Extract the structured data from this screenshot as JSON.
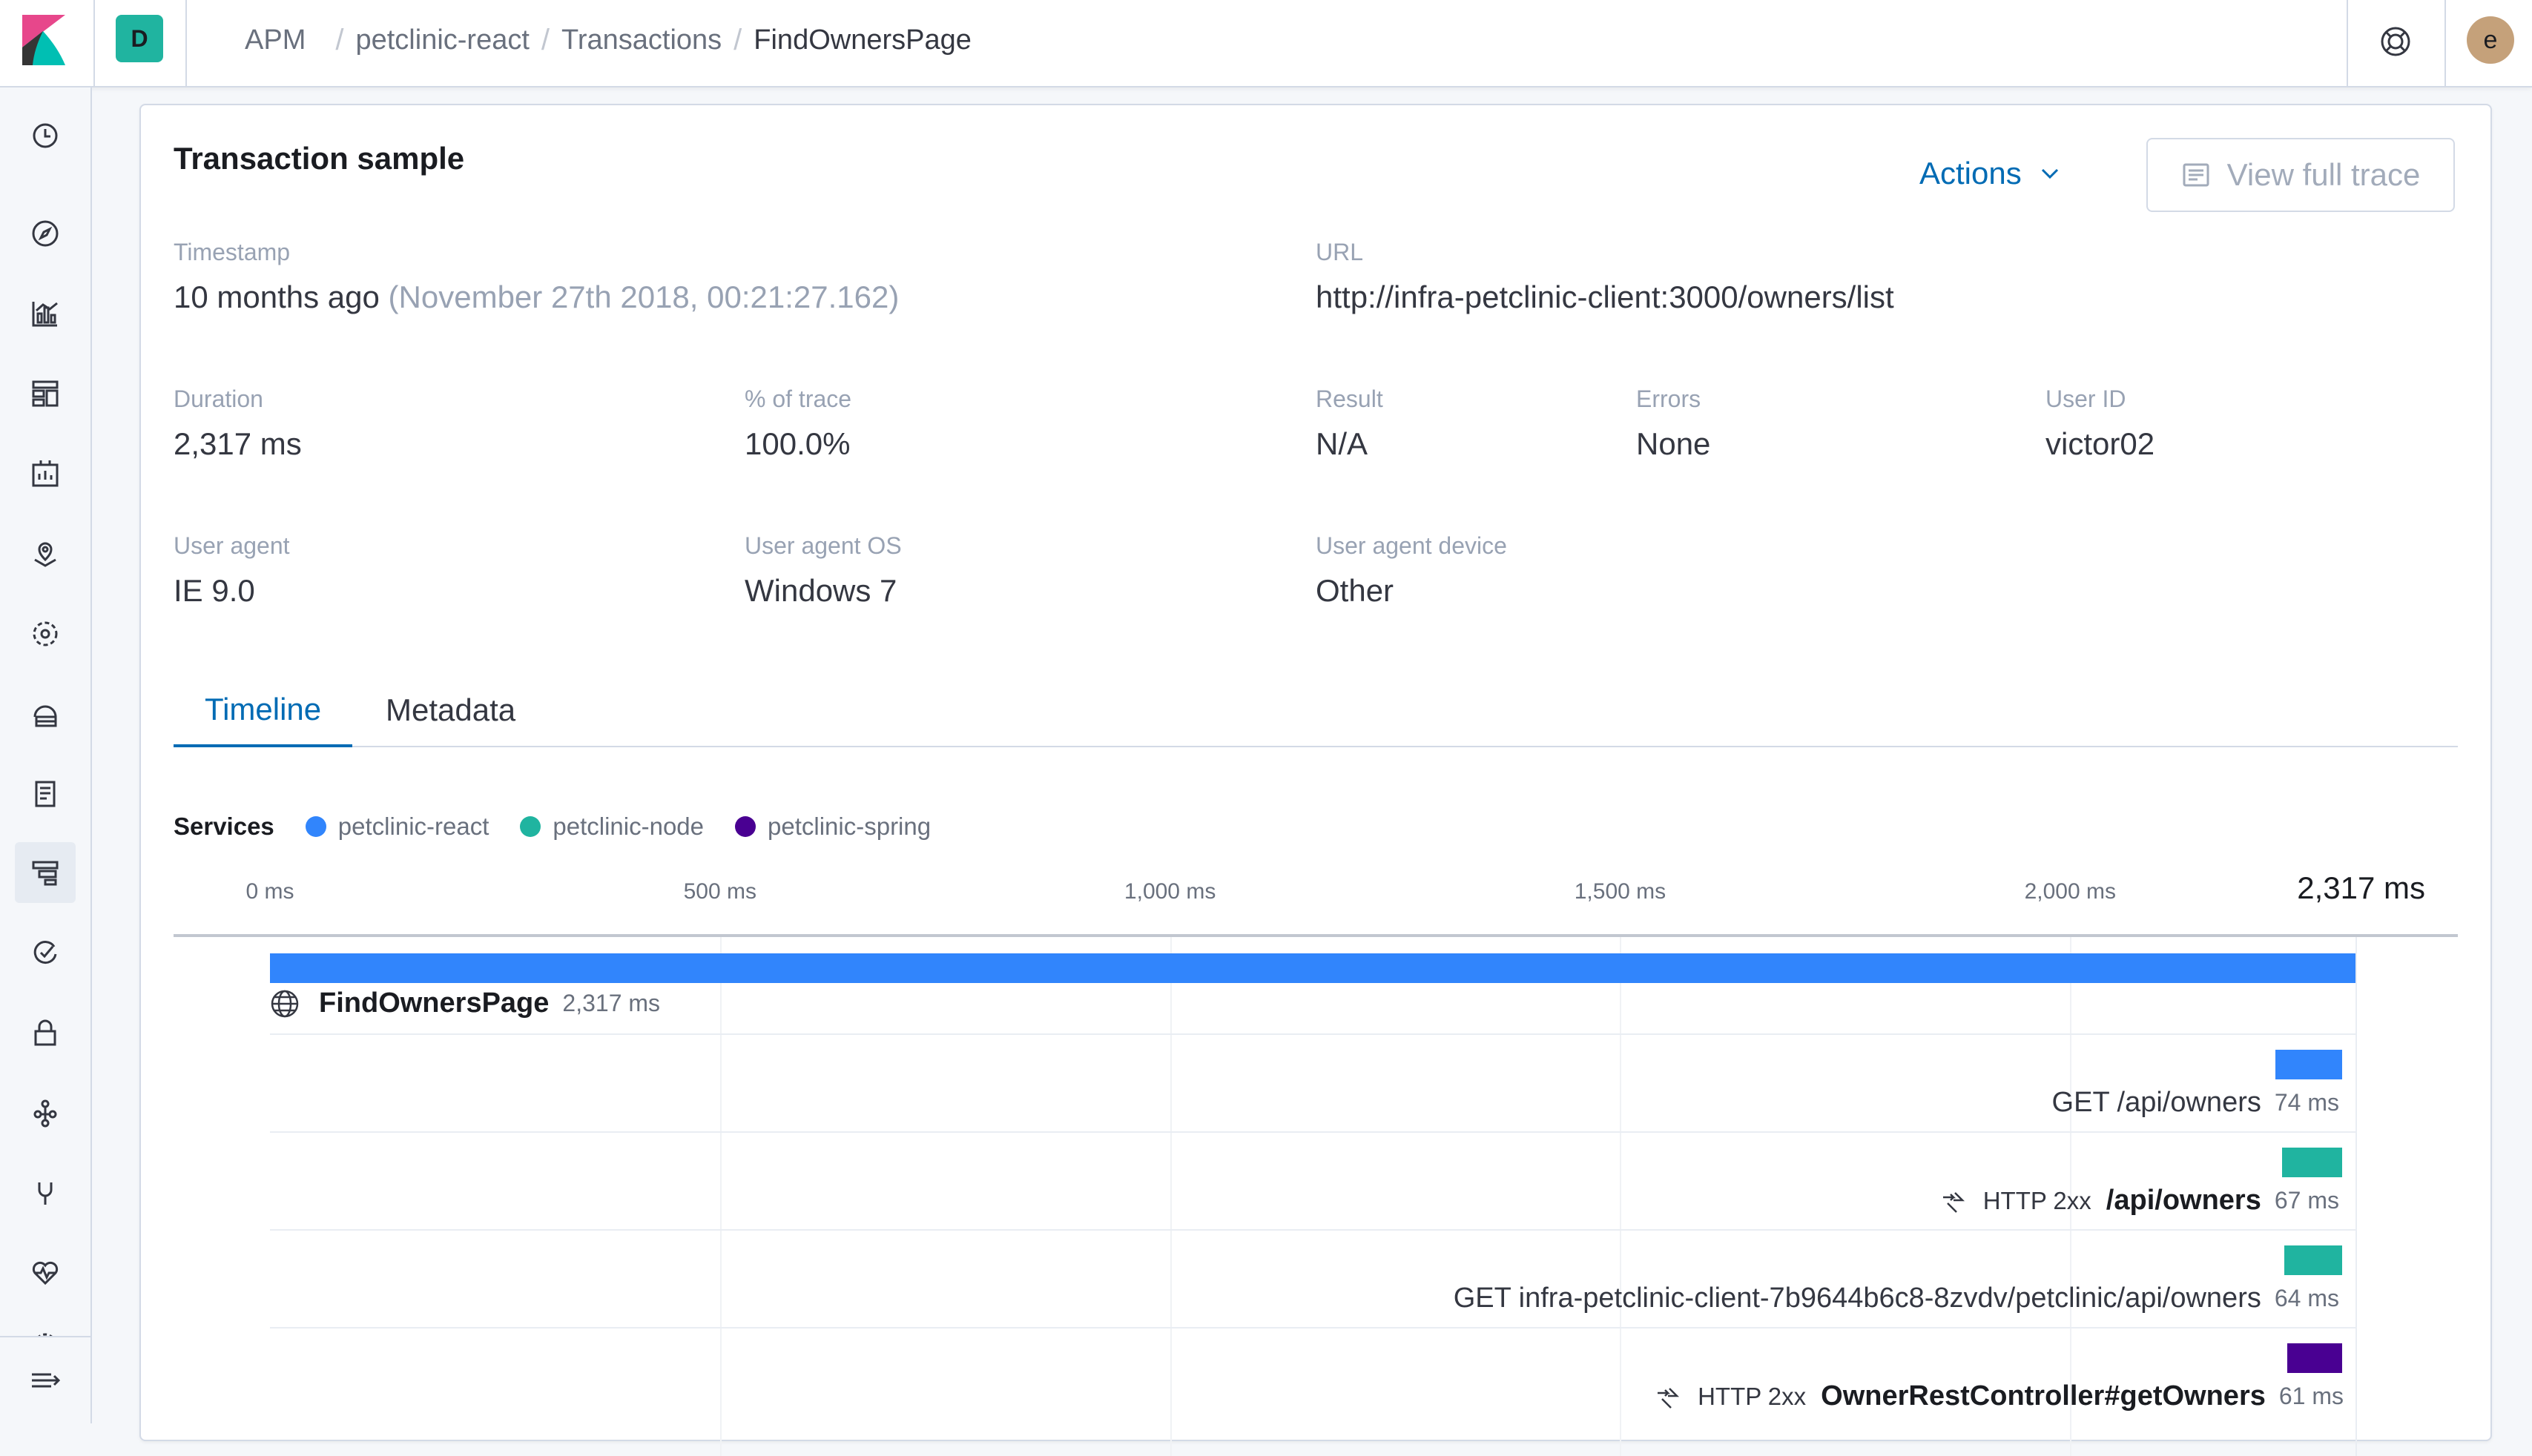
{
  "header": {
    "space_initial": "D",
    "breadcrumbs": [
      "APM",
      "petclinic-react",
      "Transactions",
      "FindOwnersPage"
    ],
    "user_initial": "e"
  },
  "colors": {
    "accent": "#006bb4",
    "react": "#3185fc",
    "node": "#20b4a0",
    "spring": "#490092"
  },
  "sidenav": {
    "items": [
      "recently-viewed",
      "discover",
      "visualize",
      "dashboard",
      "canvas",
      "maps",
      "machine-learning",
      "infrastructure",
      "logs",
      "apm",
      "uptime",
      "siem",
      "graph",
      "dev-tools",
      "monitoring",
      "management"
    ],
    "active": "apm"
  },
  "panel": {
    "title": "Transaction sample",
    "actions_label": "Actions",
    "view_trace_label": "View full trace"
  },
  "fields": {
    "timestamp": {
      "label": "Timestamp",
      "relative": "10 months ago",
      "absolute": "(November 27th 2018, 00:21:27.162)"
    },
    "url": {
      "label": "URL",
      "value": "http://infra-petclinic-client:3000/owners/list"
    },
    "duration": {
      "label": "Duration",
      "value": "2,317 ms"
    },
    "pct_trace": {
      "label": "% of trace",
      "value": "100.0%"
    },
    "result": {
      "label": "Result",
      "value": "N/A"
    },
    "errors": {
      "label": "Errors",
      "value": "None"
    },
    "user_id": {
      "label": "User ID",
      "value": "victor02"
    },
    "user_agent": {
      "label": "User agent",
      "value": "IE 9.0"
    },
    "user_agent_os": {
      "label": "User agent OS",
      "value": "Windows 7"
    },
    "user_agent_device": {
      "label": "User agent device",
      "value": "Other"
    }
  },
  "tabs": [
    {
      "label": "Timeline",
      "selected": true
    },
    {
      "label": "Metadata",
      "selected": false
    }
  ],
  "services": {
    "title": "Services",
    "items": [
      {
        "name": "petclinic-react",
        "color": "#3185fc"
      },
      {
        "name": "petclinic-node",
        "color": "#20b4a0"
      },
      {
        "name": "petclinic-spring",
        "color": "#490092"
      }
    ]
  },
  "axis": {
    "ticks": [
      "0 ms",
      "500 ms",
      "1,000 ms",
      "1,500 ms",
      "2,000 ms"
    ],
    "tick_values": [
      0,
      500,
      1000,
      1500,
      2000
    ],
    "max_ms": 2317,
    "total_label": "2,317 ms"
  },
  "spans": [
    {
      "name": "FindOwnersPage",
      "duration_label": "2,317 ms",
      "duration_ms": 2317,
      "service": "petclinic-react",
      "color": "#3185fc",
      "icon": "globe-icon"
    },
    {
      "name": "GET /api/owners",
      "duration_label": "74 ms",
      "duration_ms": 74,
      "service": "petclinic-react",
      "color": "#3185fc"
    },
    {
      "name": "/api/owners",
      "http": "HTTP 2xx",
      "duration_label": "67 ms",
      "duration_ms": 67,
      "service": "petclinic-node",
      "color": "#20b4a0",
      "icon": "exit-icon"
    },
    {
      "name": "GET infra-petclinic-client-7b9644b6c8-8zvdv/petclinic/api/owners",
      "duration_label": "64 ms",
      "duration_ms": 64,
      "service": "petclinic-node",
      "color": "#20b4a0"
    },
    {
      "name": "OwnerRestController#getOwners",
      "http": "HTTP 2xx",
      "duration_label": "61 ms",
      "duration_ms": 61,
      "service": "petclinic-spring",
      "color": "#490092",
      "icon": "exit-icon"
    }
  ]
}
